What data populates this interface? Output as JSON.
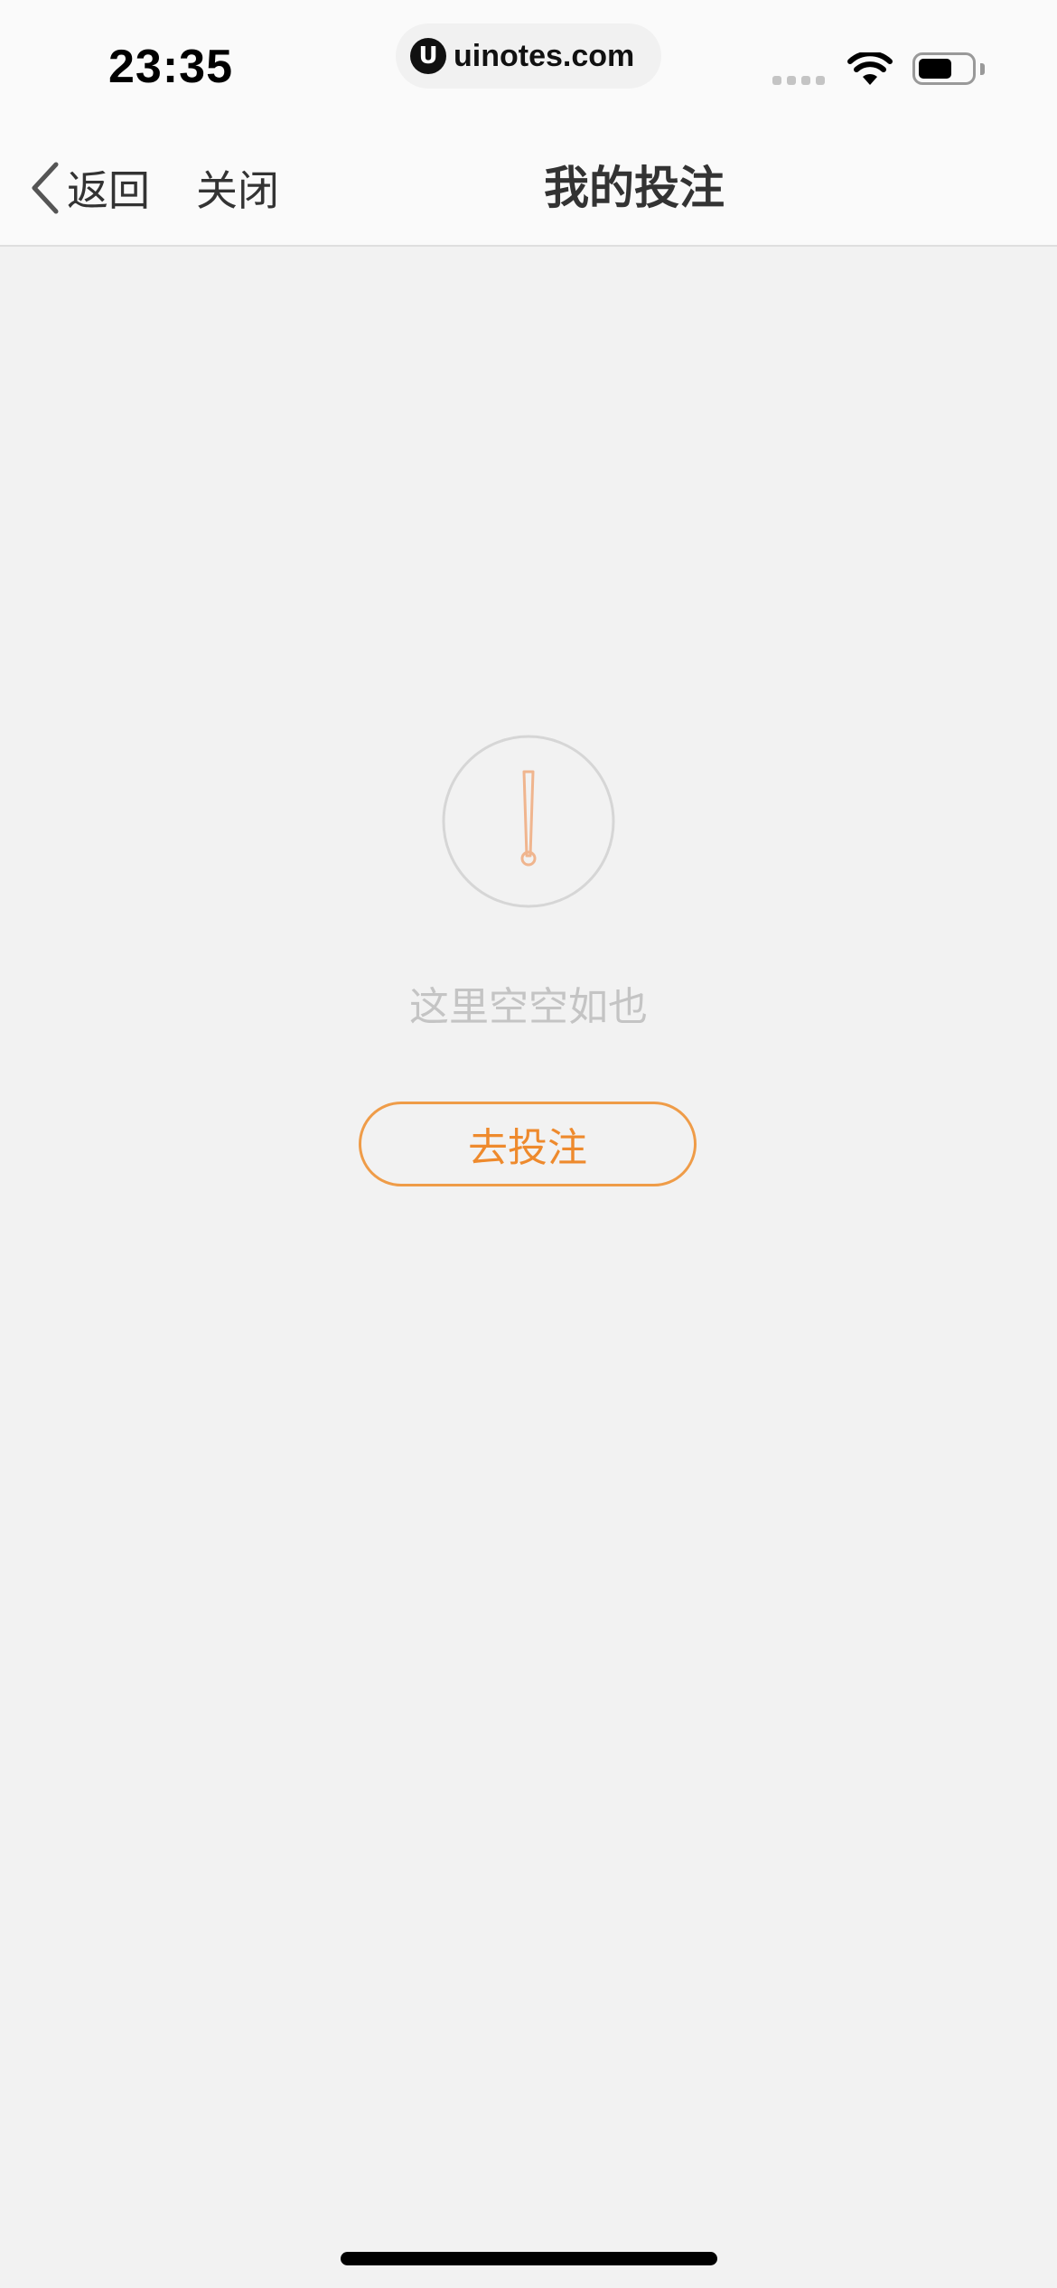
{
  "status_bar": {
    "time": "23:35",
    "url_logo": "U",
    "url": "uinotes.com",
    "icons": [
      "cellular-signal-icon",
      "wifi-icon",
      "battery-icon"
    ]
  },
  "nav": {
    "back_label": "返回",
    "close_label": "关闭",
    "title": "我的投注"
  },
  "empty_state": {
    "icon": "exclamation-circle-icon",
    "message": "这里空空如也",
    "button_label": "去投注"
  },
  "colors": {
    "accent": "#ee8a2d",
    "background": "#f2f2f2",
    "muted_text": "#c4c4c4"
  }
}
